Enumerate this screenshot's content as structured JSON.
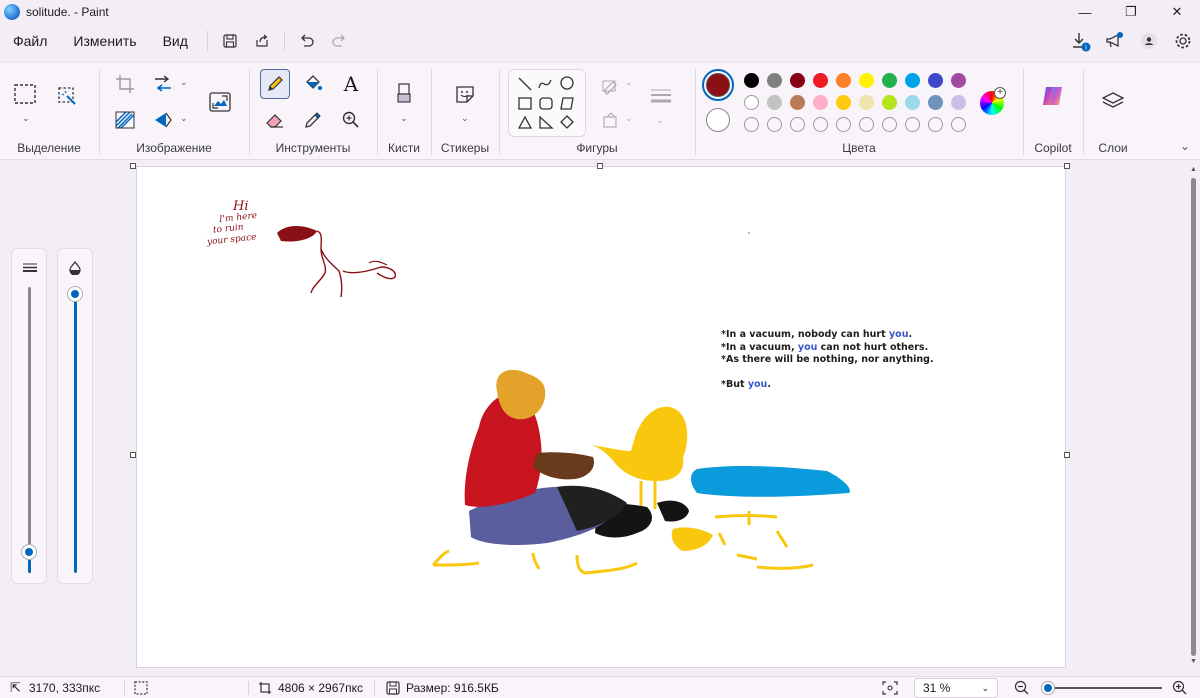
{
  "window": {
    "title": "solitude. - Paint",
    "minimize": "—",
    "restore": "❐",
    "close": "✕"
  },
  "menu": {
    "file": "Файл",
    "edit": "Изменить",
    "view": "Вид"
  },
  "ribbon": {
    "selection_label": "Выделение",
    "image_label": "Изображение",
    "tools_label": "Инструменты",
    "brushes_label": "Кисти",
    "stickers_label": "Стикеры",
    "shapes_label": "Фигуры",
    "colors_label": "Цвета",
    "copilot_label": "Copilot",
    "layers_label": "Слои",
    "text_tool": "A",
    "primary_color": "#8b1016",
    "secondary_color": "#ffffff",
    "palette_row1": [
      "#000000",
      "#7f7f7f",
      "#880015",
      "#ed1c24",
      "#ff7f27",
      "#fff200",
      "#22b14c",
      "#00a2e8",
      "#3f48cc",
      "#a349a4"
    ],
    "palette_row2": [
      "#ffffff",
      "#c3c3c3",
      "#b97a57",
      "#ffaec9",
      "#ffc90e",
      "#efe4b0",
      "#b5e61d",
      "#99d9ea",
      "#7092be",
      "#c8bfe7"
    ]
  },
  "canvas": {
    "doodle_text": [
      "Hi",
      "I'm here",
      "to ruin",
      "your space"
    ],
    "quote_line1_a": "*In a vacuum, nobody can hurt ",
    "quote_line1_b": "you",
    "quote_line1_c": ".",
    "quote_line2_a": "*In a vacuum, ",
    "quote_line2_b": "you",
    "quote_line2_c": " can not hurt others.",
    "quote_line3": "*As there will be nothing, nor anything.",
    "quote_line4_a": "*But ",
    "quote_line4_b": "you",
    "quote_line4_c": "."
  },
  "status": {
    "cursor_pos": "3170, 333пкс",
    "dimensions": "4806 × 2967пкс",
    "size": "Размер: 916.5КБ",
    "zoom": "31 %"
  }
}
